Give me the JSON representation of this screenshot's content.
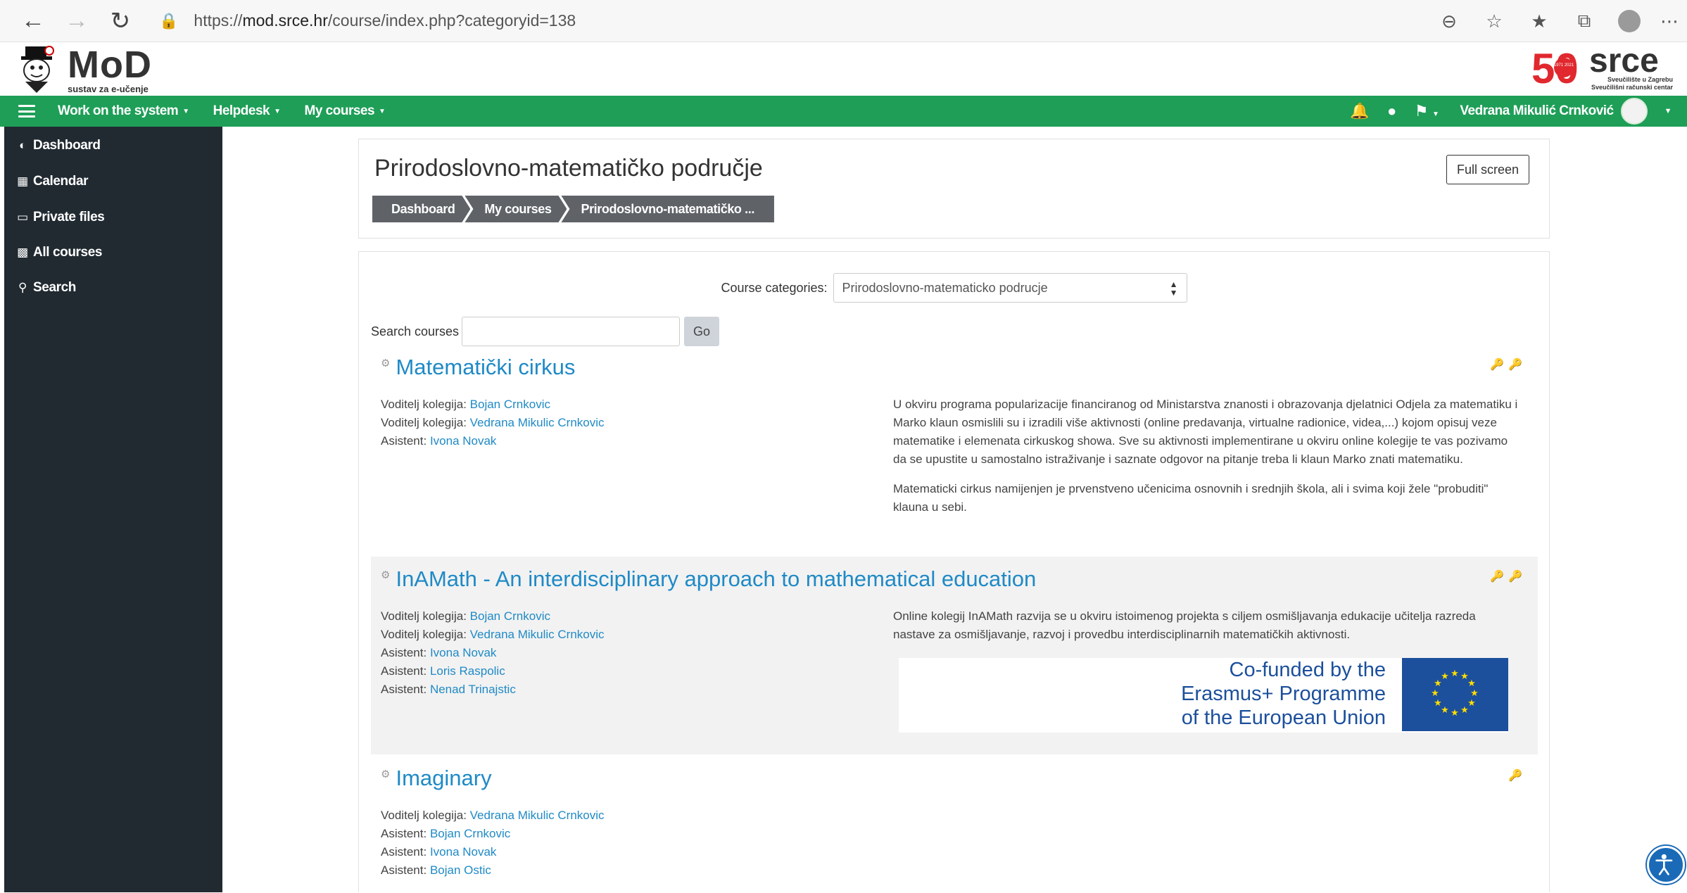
{
  "browser": {
    "url_scheme": "https://",
    "url_host": "mod.srce.hr",
    "url_path": "/course/index.php?categoryid=138"
  },
  "header": {
    "logo_title": "MoD",
    "logo_subtitle": "sustav za e-učenje",
    "partner_logo_text": "srce",
    "partner_logo_number": "50",
    "partner_logo_line1": "Sveučilište u Zagrebu",
    "partner_logo_line2": "Sveučilišni računski centar",
    "partner_logo_years": "1971 2021"
  },
  "navbar": {
    "items": [
      {
        "label": "Work on the system"
      },
      {
        "label": "Helpdesk"
      },
      {
        "label": "My courses"
      }
    ],
    "user_name": "Vedrana Mikulić Crnković",
    "color": "#1e9e57"
  },
  "sidebar": {
    "items": [
      {
        "label": "Dashboard",
        "icon": "dashboard-icon"
      },
      {
        "label": "Calendar",
        "icon": "calendar-icon"
      },
      {
        "label": "Private files",
        "icon": "files-icon"
      },
      {
        "label": "All courses",
        "icon": "courses-icon"
      },
      {
        "label": "Search",
        "icon": "search-icon"
      }
    ]
  },
  "page": {
    "title": "Prirodoslovno-matematičko područje",
    "fullscreen_label": "Full screen",
    "breadcrumb": [
      "Dashboard",
      "My courses",
      "Prirodoslovno-matematičko ..."
    ]
  },
  "filters": {
    "category_label": "Course categories:",
    "category_value": "Prirodoslovno-matematicko podrucje",
    "search_label": "Search courses",
    "search_value": "",
    "go_label": "Go"
  },
  "courses": [
    {
      "name": "Matematički cirkus",
      "teachers": [
        {
          "role": "Voditelj kolegija:",
          "name": "Bojan Crnkovic"
        },
        {
          "role": "Voditelj kolegija:",
          "name": "Vedrana Mikulic Crnkovic"
        },
        {
          "role": "Asistent:",
          "name": "Ivona Novak"
        }
      ],
      "summary": [
        "U okviru programa popularizacije financiranog od Ministarstva znanosti i obrazovanja djelatnici Odjela za matematiku i Marko klaun osmislili su i izradili više aktivnosti (online predavanja, virtualne radionice, videa,...) kojom opisuj veze matematike i elemenata cirkuskog showa. Sve su aktivnosti implementirane u okviru online kolegije te vas pozivamo da se upustite u samostalno istraživanje i saznate odgovor na pitanje treba li klaun Marko znati matematiku.",
        "Matematicki cirkus namijenjen je prvenstveno učenicima osnovnih i srednjih škola, ali i svima koji žele \"probuditi\" klauna u sebi."
      ]
    },
    {
      "name": "InAMath - An interdisciplinary approach to mathematical education",
      "teachers": [
        {
          "role": "Voditelj kolegija:",
          "name": "Bojan Crnkovic"
        },
        {
          "role": "Voditelj kolegija:",
          "name": "Vedrana Mikulic Crnkovic"
        },
        {
          "role": "Asistent:",
          "name": "Ivona Novak"
        },
        {
          "role": "Asistent:",
          "name": "Loris Raspolic"
        },
        {
          "role": "Asistent:",
          "name": "Nenad Trinajstic"
        }
      ],
      "summary": [
        "Online kolegij InAMath razvija se u okviru istoimenog projekta s ciljem osmišljavanja edukacije učitelja razreda nastave za osmišljavanje, razvoj i provedbu interdisciplinarnih matematičkih aktivnosti."
      ],
      "banner_lines": [
        "Co-funded by the",
        "Erasmus+ Programme",
        "of the European Union"
      ]
    },
    {
      "name": "Imaginary",
      "teachers": [
        {
          "role": "Voditelj kolegija:",
          "name": "Vedrana Mikulic Crnkovic"
        },
        {
          "role": "Asistent:",
          "name": "Bojan Crnkovic"
        },
        {
          "role": "Asistent:",
          "name": "Ivona Novak"
        },
        {
          "role": "Asistent:",
          "name": "Bojan Ostic"
        }
      ],
      "summary": []
    }
  ]
}
